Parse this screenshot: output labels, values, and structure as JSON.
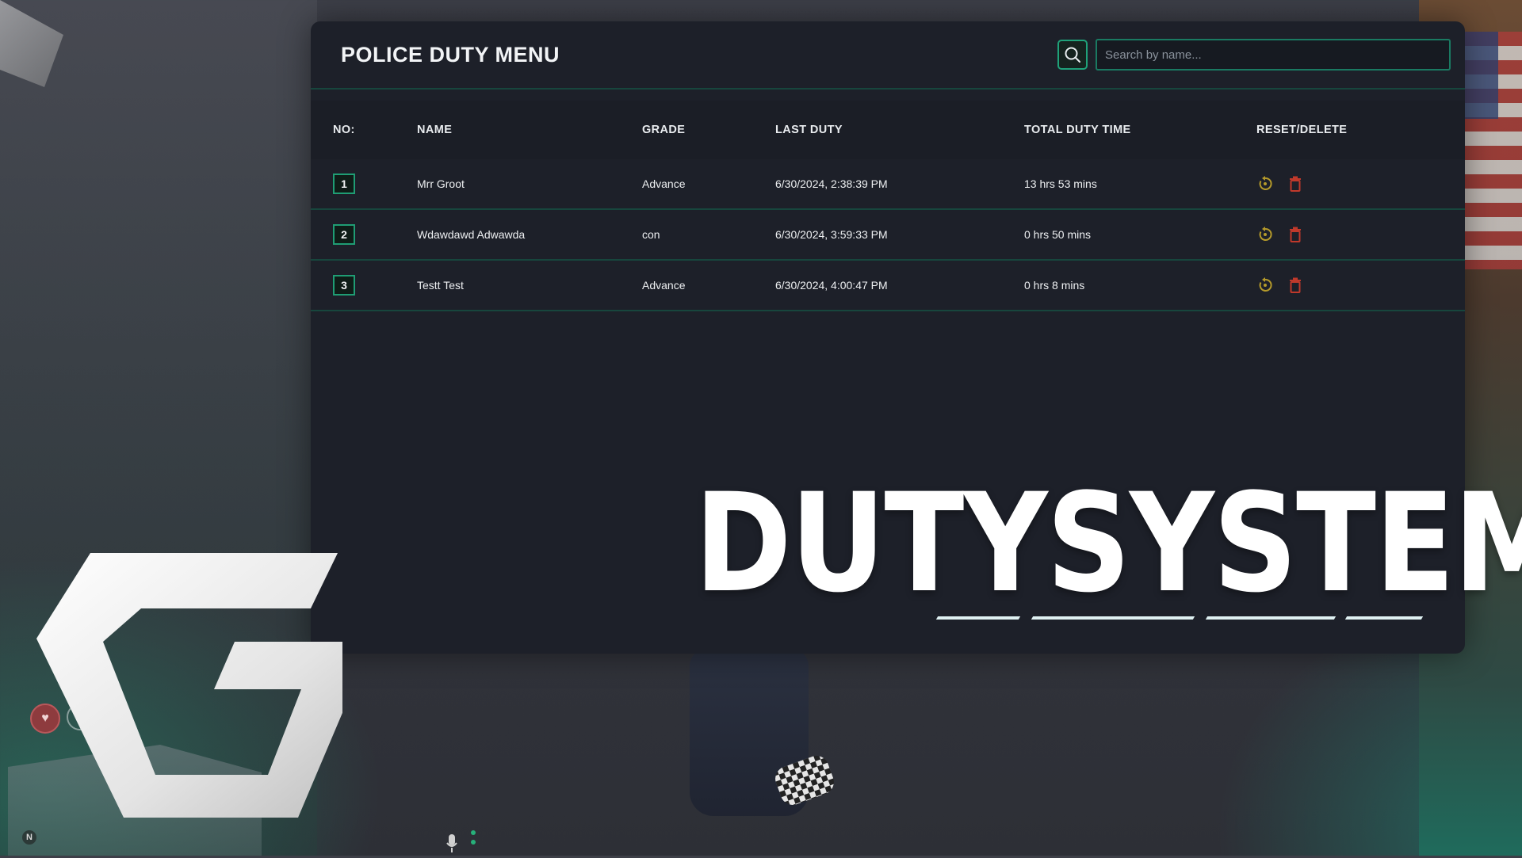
{
  "panel": {
    "title": "POLICE DUTY MENU",
    "search": {
      "placeholder": "Search by name..."
    }
  },
  "table": {
    "headers": {
      "no": "NO:",
      "name": "NAME",
      "grade": "GRADE",
      "last_duty": "LAST DUTY",
      "total_duty_time": "TOTAL DUTY TIME",
      "reset_delete": "RESET/DELETE"
    },
    "rows": [
      {
        "no": "1",
        "name": "Mrr Groot",
        "grade": "Advance",
        "last_duty": "6/30/2024, 2:38:39 PM",
        "total_duty_time": "13 hrs 53 mins"
      },
      {
        "no": "2",
        "name": "Wdawdawd Adwawda",
        "grade": "con",
        "last_duty": "6/30/2024, 3:59:33 PM",
        "total_duty_time": "0 hrs 50 mins"
      },
      {
        "no": "3",
        "name": "Testt Test",
        "grade": "Advance",
        "last_duty": "6/30/2024, 4:00:47 PM",
        "total_duty_time": "0 hrs 8 mins"
      }
    ]
  },
  "branding": {
    "title": "DUTYSYSTEM"
  },
  "hud": {
    "compass": "N"
  },
  "icons": {
    "search": "search-icon",
    "reset": "reset-icon",
    "delete": "trash-icon",
    "health": "heart-icon",
    "voice": "microphone-icon",
    "logo": "g-logo-icon"
  },
  "colors": {
    "panel_bg": "#1d2029",
    "accent_green": "#1f9d74",
    "reset_icon": "#b59a2a",
    "delete_icon": "#c0392b",
    "text": "#eef0f2"
  }
}
